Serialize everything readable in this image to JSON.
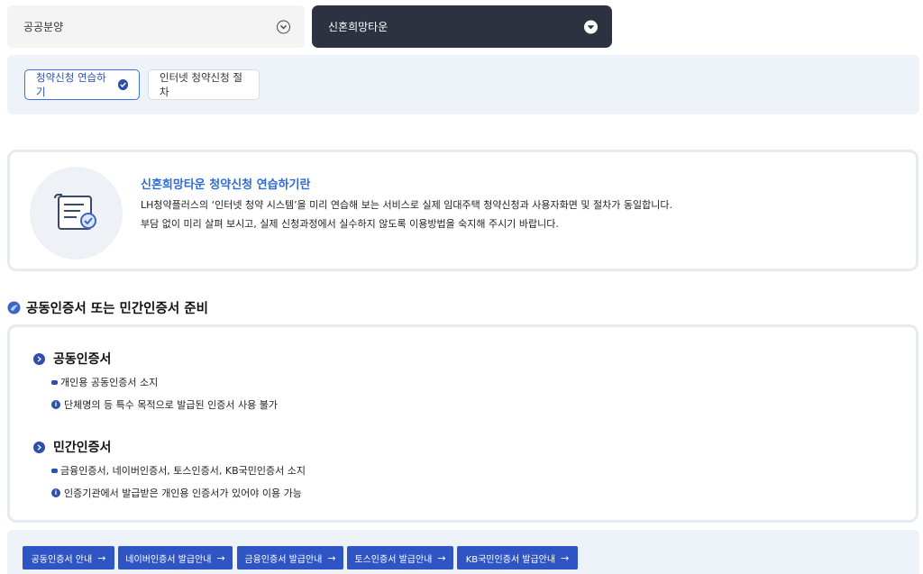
{
  "tabs": [
    {
      "label": "공공분양",
      "icon": "chevron-down-circle-icon",
      "active": false
    },
    {
      "label": "신혼희망타운",
      "icon": "chevron-down-circle-icon",
      "active": true
    }
  ],
  "sub_tabs": [
    {
      "label": "청약신청 연습하기",
      "active": true,
      "icon": "check-circle-icon"
    },
    {
      "label": "인터넷 청약신청 절차",
      "active": false
    }
  ],
  "info": {
    "icon": "document-check-icon",
    "title": "신혼희망타운 청약신청 연습하기란",
    "line1": "LH청약플러스의 ‘인터넷 청약 시스템’을 미리 연습해 보는 서비스로 실제 임대주택 청약신청과 사용자화면 및 절차가 동일합니다.",
    "line2": "부담 없이 미리 살펴 보시고, 실제 신청과정에서 실수하지 않도록 이용방법을 숙지해 주시기 바랍니다."
  },
  "section": {
    "title": "공동인증서 또는 민간인증서 준비",
    "icon": "check-badge-icon"
  },
  "cert_groups": [
    {
      "title": "공동인증서",
      "items": [
        {
          "type": "dash",
          "text": "개인용 공동인증서 소지"
        },
        {
          "type": "info",
          "text": "단체명의 등 특수 목적으로 발급된 인증서 사용 불가"
        }
      ]
    },
    {
      "title": "민간인증서",
      "items": [
        {
          "type": "dash",
          "text": "금융인증서, 네이버인증서, 토스인증서, KB국민인증서 소지"
        },
        {
          "type": "info",
          "text": "인증기관에서 발급받은 개인용 인증서가 있어야 이용 가능"
        }
      ]
    }
  ],
  "guide_buttons": [
    {
      "label": "공동인증서 안내"
    },
    {
      "label": "네이버인증서 발급안내"
    },
    {
      "label": "금융인증서 발급안내"
    },
    {
      "label": "토스인증서 발급안내"
    },
    {
      "label": "KB국민인증서 발급안내"
    }
  ],
  "colors": {
    "accent": "#2f55c5",
    "active_tab": "#2c3240",
    "panel_bg": "#eef2f9",
    "title_blue": "#2f6bd6"
  }
}
